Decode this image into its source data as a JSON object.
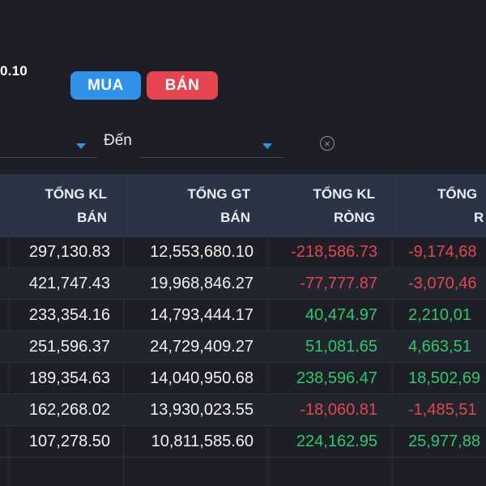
{
  "header": {
    "price_fragment": "0.10"
  },
  "trade_buttons": {
    "buy_label": "MUA",
    "sell_label": "BÁN"
  },
  "filters": {
    "to_label": "Đến",
    "from_value": "",
    "to_value": ""
  },
  "table": {
    "headers": [
      {
        "line1": "TỔNG KL",
        "line2": "BÁN"
      },
      {
        "line1": "TỔNG GT",
        "line2": "BÁN"
      },
      {
        "line1": "TỔNG KL",
        "line2": "RÒNG"
      },
      {
        "line1": "TỔNG",
        "line2": "R"
      }
    ],
    "rows": [
      {
        "kl_ban": "297,130.83",
        "gt_ban": "12,553,680.10",
        "kl_rong": "-218,586.73",
        "gt_rong": "-9,174,68"
      },
      {
        "kl_ban": "421,747.43",
        "gt_ban": "19,968,846.27",
        "kl_rong": "-77,777.87",
        "gt_rong": "-3,070,46"
      },
      {
        "kl_ban": "233,354.16",
        "gt_ban": "14,793,444.17",
        "kl_rong": "40,474.97",
        "gt_rong": "2,210,01"
      },
      {
        "kl_ban": "251,596.37",
        "gt_ban": "24,729,409.27",
        "kl_rong": "51,081.65",
        "gt_rong": "4,663,51"
      },
      {
        "kl_ban": "189,354.63",
        "gt_ban": "14,040,950.68",
        "kl_rong": "238,596.47",
        "gt_rong": "18,502,69"
      },
      {
        "kl_ban": "162,268.02",
        "gt_ban": "13,930,023.55",
        "kl_rong": "-18,060.81",
        "gt_rong": "-1,485,51"
      },
      {
        "kl_ban": "107,278.50",
        "gt_ban": "10,811,585.60",
        "kl_rong": "224,162.95",
        "gt_rong": "25,977,88"
      }
    ]
  },
  "colors": {
    "background": "#1e1f26",
    "header_bg": "#2b3445",
    "buy": "#2f93e8",
    "sell": "#e5454f",
    "positive": "#2dc86a",
    "negative": "#e5454f"
  }
}
